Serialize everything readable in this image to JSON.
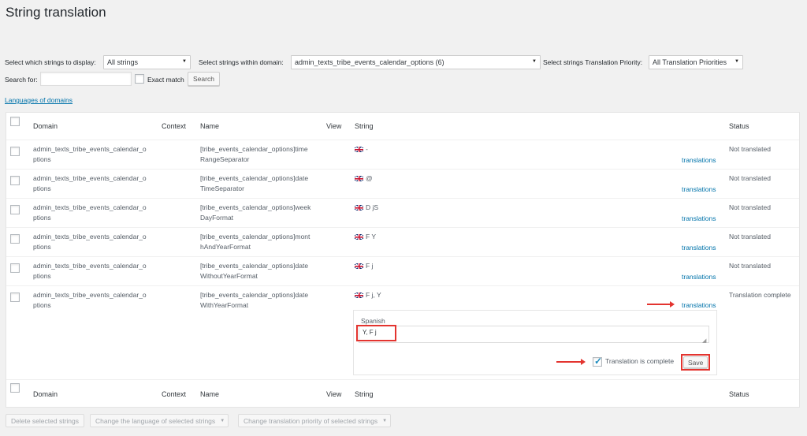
{
  "page_title": "String translation",
  "filters": {
    "display_label": "Select which strings to display:",
    "display_value": "All strings",
    "domain_label": "Select strings within domain:",
    "domain_value": "admin_texts_tribe_events_calendar_options (6)",
    "priority_label": "Select strings Translation Priority:",
    "priority_value": "All Translation Priorities",
    "search_label": "Search for:",
    "search_value": "",
    "exact_match_label": "Exact match",
    "search_button": "Search"
  },
  "languages_link": "Languages of domains",
  "table": {
    "headers": {
      "domain": "Domain",
      "context": "Context",
      "name": "Name",
      "view": "View",
      "string": "String",
      "status": "Status"
    },
    "rows": [
      {
        "domain_1": "admin_texts_tribe_events_calendar_o",
        "domain_2": "ptions",
        "name_1": "[tribe_events_calendar_options]time",
        "name_2": "RangeSeparator",
        "string": "-",
        "link": "translations",
        "status": "Not translated"
      },
      {
        "domain_1": "admin_texts_tribe_events_calendar_o",
        "domain_2": "ptions",
        "name_1": "[tribe_events_calendar_options]date",
        "name_2": "TimeSeparator",
        "string": "@",
        "link": "translations",
        "status": "Not translated"
      },
      {
        "domain_1": "admin_texts_tribe_events_calendar_o",
        "domain_2": "ptions",
        "name_1": "[tribe_events_calendar_options]week",
        "name_2": "DayFormat",
        "string": "D jS",
        "link": "translations",
        "status": "Not translated"
      },
      {
        "domain_1": "admin_texts_tribe_events_calendar_o",
        "domain_2": "ptions",
        "name_1": "[tribe_events_calendar_options]mont",
        "name_2": "hAndYearFormat",
        "string": "F Y",
        "link": "translations",
        "status": "Not translated"
      },
      {
        "domain_1": "admin_texts_tribe_events_calendar_o",
        "domain_2": "ptions",
        "name_1": "[tribe_events_calendar_options]date",
        "name_2": "WithoutYearFormat",
        "string": "F j",
        "link": "translations",
        "status": "Not translated"
      },
      {
        "domain_1": "admin_texts_tribe_events_calendar_o",
        "domain_2": "ptions",
        "name_1": "[tribe_events_calendar_options]date",
        "name_2": "WithYearFormat",
        "string": "F j, Y",
        "link": "translations",
        "status": "Translation complete"
      }
    ]
  },
  "editor": {
    "language": "Spanish",
    "value": "Y, F j",
    "complete_label": "Translation is complete",
    "save_button": "Save"
  },
  "bulk": {
    "delete": "Delete selected strings",
    "change_language": "Change the language of selected strings",
    "change_priority": "Change translation priority of selected strings"
  },
  "colors": {
    "accent": "#0073aa",
    "annotation": "#e3342f",
    "check": "#1e8cbe"
  }
}
